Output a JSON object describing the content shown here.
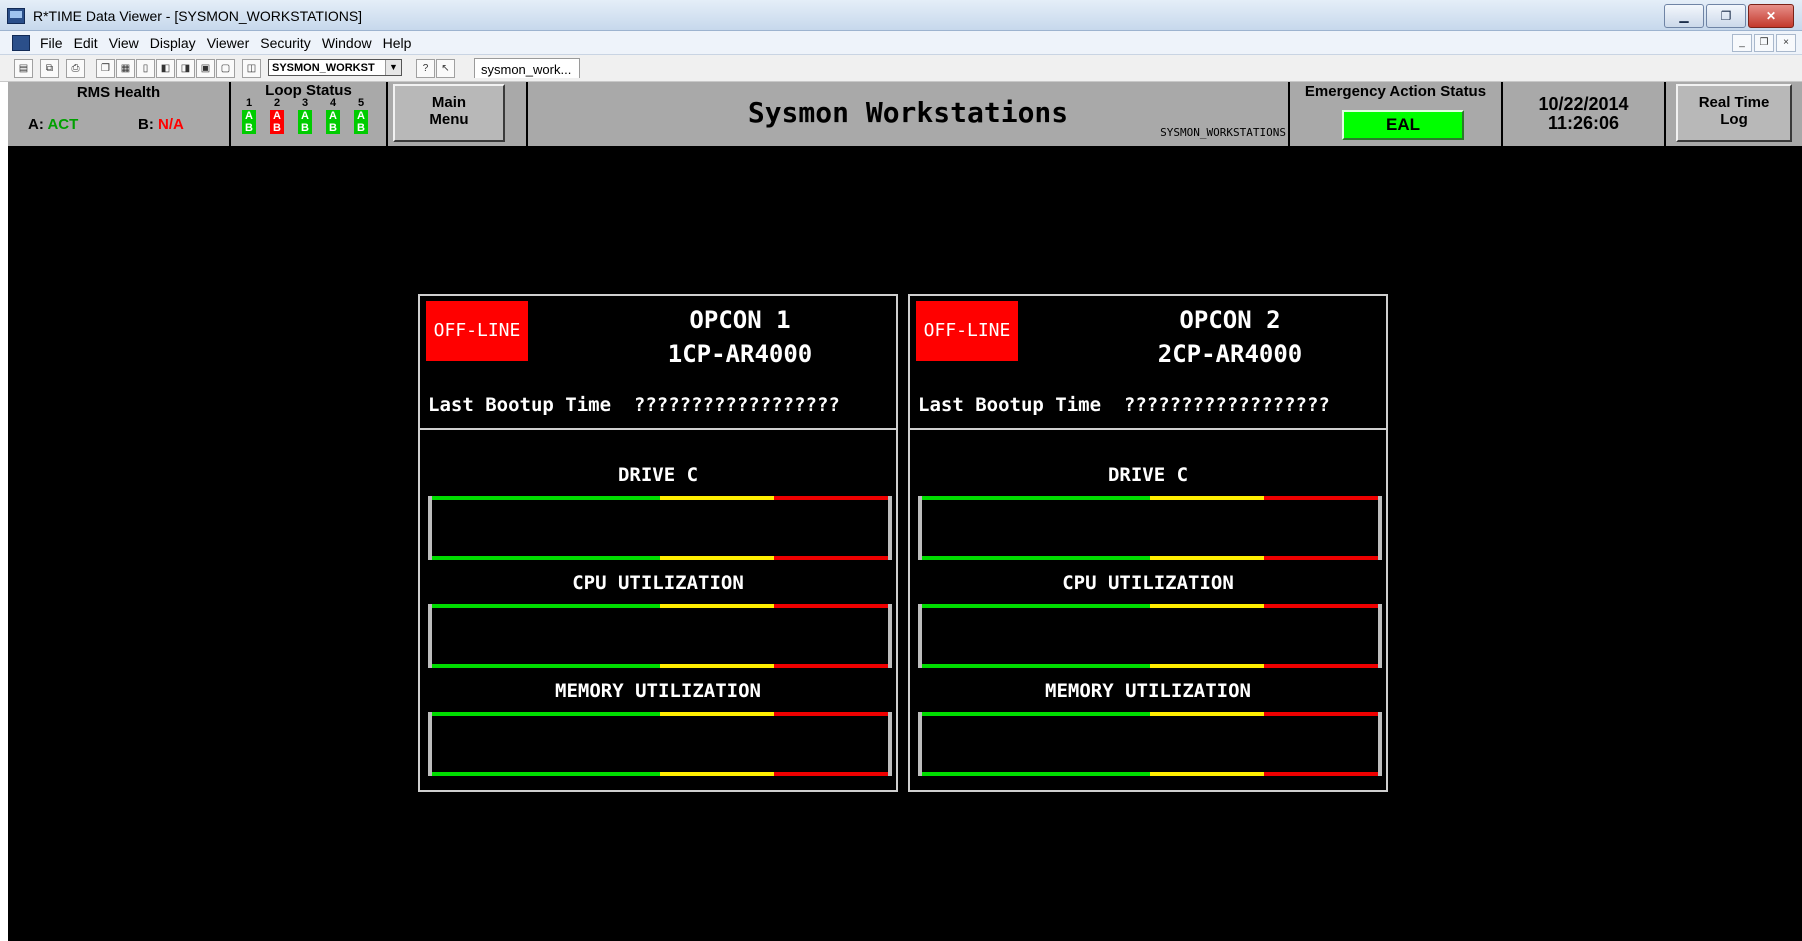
{
  "window": {
    "title": "R*TIME Data Viewer - [SYSMON_WORKSTATIONS]"
  },
  "menubar": {
    "items": [
      "File",
      "Edit",
      "View",
      "Display",
      "Viewer",
      "Security",
      "Window",
      "Help"
    ]
  },
  "toolbar": {
    "display_select": "SYSMON_WORKST",
    "tab_label": "sysmon_work..."
  },
  "header": {
    "rms": {
      "title": "RMS Health",
      "a_label": "A:",
      "a_value": "ACT",
      "b_label": "B:",
      "b_value": "N/A"
    },
    "loop": {
      "title": "Loop Status",
      "loops": [
        {
          "num": "1",
          "a": "A",
          "b": "B",
          "a_status": "ok",
          "b_status": "ok"
        },
        {
          "num": "2",
          "a": "A",
          "b": "B",
          "a_status": "alarm",
          "b_status": "alarm"
        },
        {
          "num": "3",
          "a": "A",
          "b": "B",
          "a_status": "ok",
          "b_status": "ok"
        },
        {
          "num": "4",
          "a": "A",
          "b": "B",
          "a_status": "ok",
          "b_status": "ok"
        },
        {
          "num": "5",
          "a": "A",
          "b": "B",
          "a_status": "ok",
          "b_status": "ok"
        }
      ]
    },
    "main_menu": {
      "line1": "Main",
      "line2": "Menu"
    },
    "title": "Sysmon Workstations",
    "subtitle": "SYSMON_WORKSTATIONS",
    "emergency": {
      "title": "Emergency Action Status",
      "value": "EAL"
    },
    "datetime": {
      "date": "10/22/2014",
      "time": "11:26:06"
    },
    "realtime": {
      "line1": "Real Time",
      "line2": "Log"
    }
  },
  "workstations": [
    {
      "status": "OFF-LINE",
      "name": "OPCON 1",
      "host": "1CP-AR4000",
      "boot_label": "Last Bootup Time",
      "boot_value": "??????????????????",
      "meters": [
        {
          "label": "DRIVE C"
        },
        {
          "label": "CPU UTILIZATION"
        },
        {
          "label": "MEMORY UTILIZATION"
        }
      ]
    },
    {
      "status": "OFF-LINE",
      "name": "OPCON 2",
      "host": "2CP-AR4000",
      "boot_label": "Last Bootup Time",
      "boot_value": "??????????????????",
      "meters": [
        {
          "label": "DRIVE C"
        },
        {
          "label": "CPU UTILIZATION"
        },
        {
          "label": "MEMORY UTILIZATION"
        }
      ]
    }
  ],
  "colors": {
    "ok": "#00cc00",
    "alarm": "#ff0000",
    "meter_green": "#00dd00",
    "meter_yellow": "#ffee00",
    "meter_red": "#ee0000",
    "offline": "#ff0000"
  }
}
